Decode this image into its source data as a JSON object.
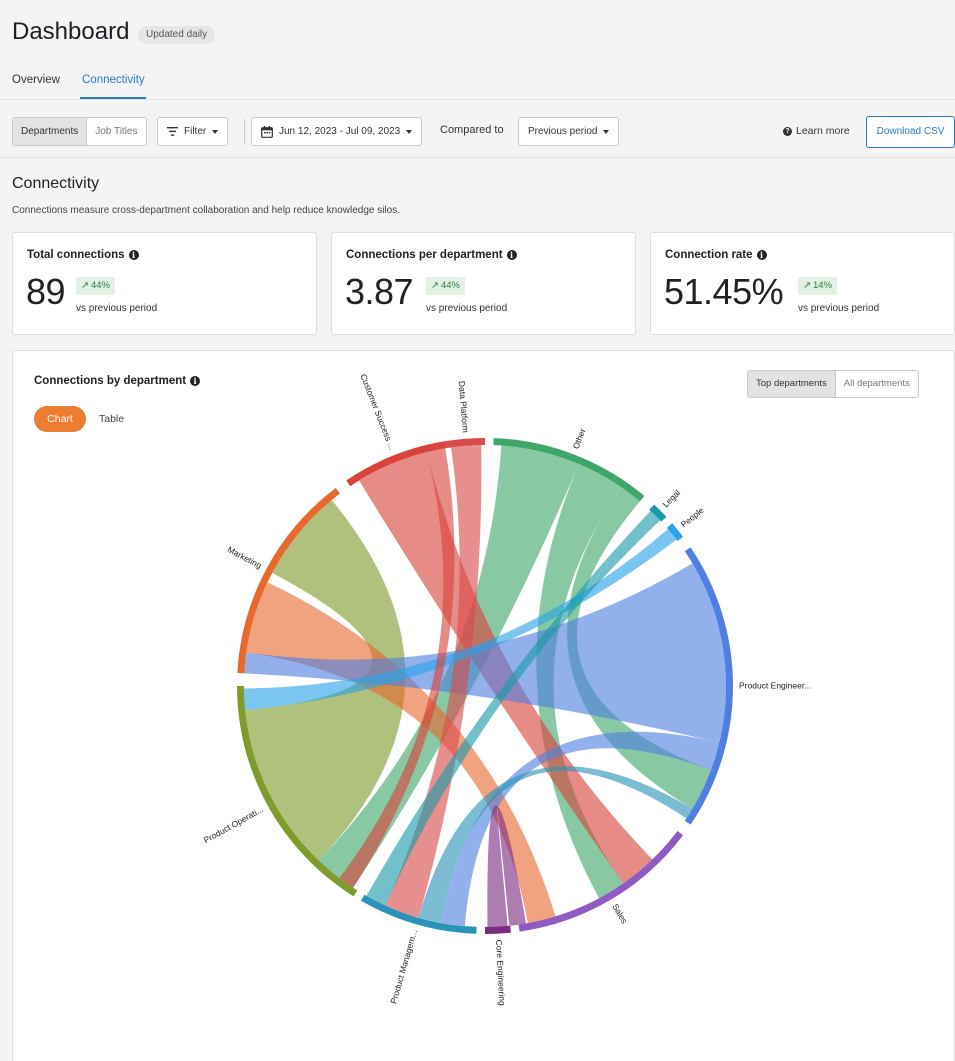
{
  "header": {
    "title": "Dashboard",
    "badge": "Updated daily",
    "tabs": [
      {
        "label": "Overview",
        "active": false
      },
      {
        "label": "Connectivity",
        "active": true
      }
    ]
  },
  "toolbar": {
    "view_toggle": [
      "Departments",
      "Job Titles"
    ],
    "view_selected": "Departments",
    "filter_label": "Filter",
    "date_range": "Jun 12, 2023 - Jul 09, 2023",
    "compared_label": "Compared to",
    "compared_value": "Previous period",
    "learn_more": "Learn more",
    "download": "Download CSV"
  },
  "section": {
    "title": "Connectivity",
    "description": "Connections measure cross-department collaboration and help reduce knowledge silos."
  },
  "metrics": [
    {
      "label": "Total connections",
      "value": "89",
      "delta": "44%",
      "vs": "vs previous period"
    },
    {
      "label": "Connections per department",
      "value": "3.87",
      "delta": "44%",
      "vs": "vs previous period"
    },
    {
      "label": "Connection rate",
      "value": "51.45%",
      "delta": "14%",
      "vs": "vs previous period"
    }
  ],
  "panel": {
    "title": "Connections by department",
    "scope_toggle": [
      "Top departments",
      "All departments"
    ],
    "scope_selected": "Top departments",
    "view_modes": [
      "Chart",
      "Table"
    ],
    "view_selected": "Chart"
  },
  "colors": {
    "accent": "#2b78c5",
    "orange": "#ed7d31",
    "positive": "#2e7d3b"
  },
  "chart_data": {
    "type": "chord",
    "departments": [
      {
        "name": "Data Platform",
        "color": "#d94a4a"
      },
      {
        "name": "Other",
        "color": "#3fa66a"
      },
      {
        "name": "Legal",
        "color": "#1b9aaa"
      },
      {
        "name": "People",
        "color": "#2aa3e8"
      },
      {
        "name": "Product Engineer...",
        "color": "#4f7fe0"
      },
      {
        "name": "Sales",
        "color": "#8f5bc2"
      },
      {
        "name": "Core Engineering",
        "color": "#7a2b7f"
      },
      {
        "name": "Product Managem...",
        "color": "#2a93b8"
      },
      {
        "name": "Product Operati...",
        "color": "#7e9b2b"
      },
      {
        "name": "Marketing",
        "color": "#e8692e"
      },
      {
        "name": "Customer Success ...",
        "color": "#d9433b"
      }
    ]
  }
}
